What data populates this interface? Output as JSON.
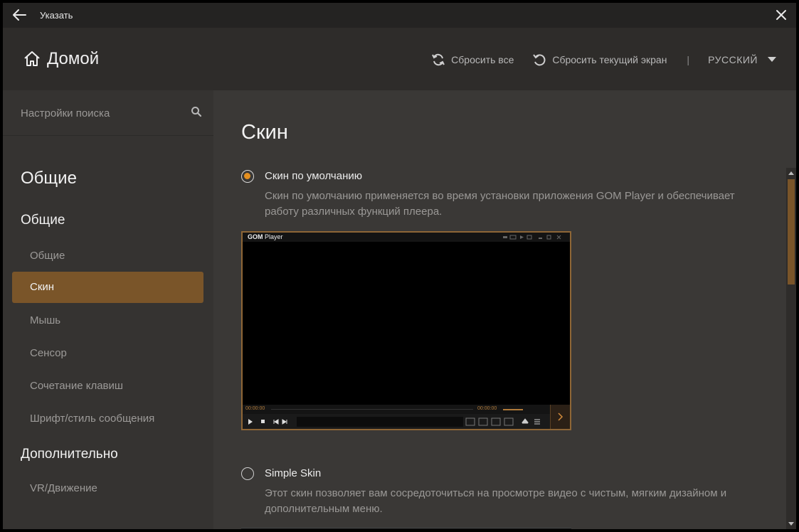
{
  "titlebar": {
    "title": "Указать",
    "back_icon": "arrow-left-icon",
    "close_icon": "close-icon"
  },
  "header": {
    "home_label": "Домой",
    "reset_all": "Сбросить все",
    "reset_current": "Сбросить текущий экран",
    "separator": "|",
    "language": "РУССКИЙ"
  },
  "sidebar": {
    "search_placeholder": "Настройки поиска",
    "section_title": "Общие",
    "group1_title": "Общие",
    "items": [
      {
        "label": "Общие",
        "active": false
      },
      {
        "label": "Скин",
        "active": true
      },
      {
        "label": "Мышь",
        "active": false
      },
      {
        "label": "Сенсор",
        "active": false
      },
      {
        "label": "Сочетание клавиш",
        "active": false
      },
      {
        "label": "Шрифт/стиль сообщения",
        "active": false
      }
    ],
    "group2_title": "Дополнительно",
    "items2": [
      {
        "label": "VR/Движение",
        "active": false
      }
    ]
  },
  "content": {
    "title": "Скин",
    "options": [
      {
        "label": "Скин по умолчанию",
        "selected": true,
        "description": "Скин по умолчанию применяется во время установки приложения GOM Player и обеспечивает работу различных функций плеера."
      },
      {
        "label": "Simple Skin",
        "selected": false,
        "description": "Этот скин позволяет вам сосредоточиться на просмотре видео с чистым, мягким дизайном и дополнительным меню."
      }
    ],
    "preview": {
      "logo_bold": "GOM",
      "logo_rest": " Player",
      "time_left": "00:00:00",
      "time_right": "00:00:00"
    }
  },
  "colors": {
    "accent": "#7a5529",
    "radio_checked": "#e48f1f",
    "background": "#3a3836",
    "sidebar": "#353331"
  }
}
